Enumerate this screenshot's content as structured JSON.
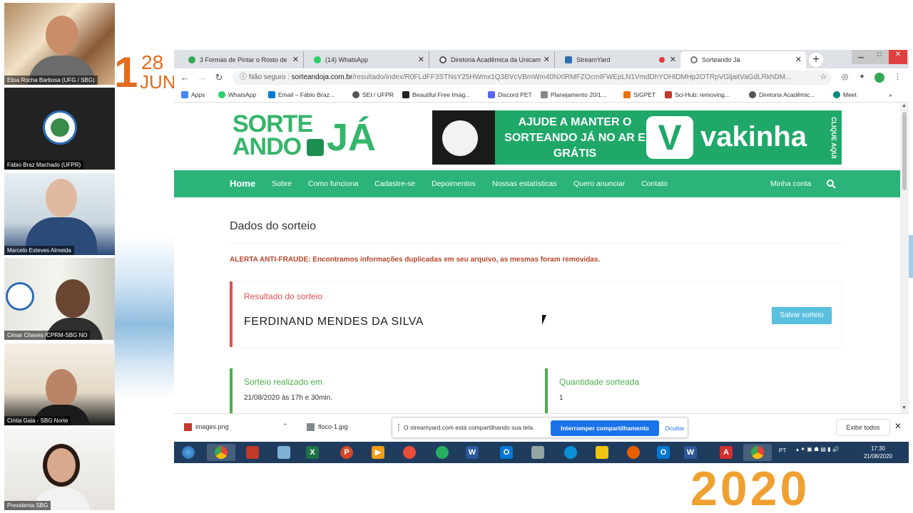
{
  "event": {
    "date_first_digit": "1",
    "date_day": "28",
    "date_month": "JUN",
    "year": "2020"
  },
  "participants": [
    {
      "name": "Elisa Rocha Barbosa (UFG / SBG)"
    },
    {
      "name": "Fábio Braz Machado (UFPR)"
    },
    {
      "name": "Marcelo Esteves Almeida"
    },
    {
      "name": "César Chaves /CPRM-SBG NO"
    },
    {
      "name": "Cintia Gaia - SBG Norte"
    },
    {
      "name": "Presidenta SBG"
    }
  ],
  "browser": {
    "tabs": [
      {
        "label": "3 Formas de Pintar o Rosto de",
        "icon_color": "#34a853"
      },
      {
        "label": "(14) WhatsApp",
        "icon_color": "#25d366"
      },
      {
        "label": "Diretoria Acadêmica da Unicam",
        "icon_color": "#555555"
      },
      {
        "label": "StreamYard",
        "icon_color": "#2f6fb0"
      },
      {
        "label": "Sorteando Já",
        "icon_color": "#777777"
      }
    ],
    "address": {
      "security_label": "Não seguro",
      "domain": "sorteandoja.com.br",
      "path": "/resultado/index/R0FLdFF3STNsY25HWmx1Q3BVcVBmWm40NXlRMFZOcmtFWEpLN1VmdDhYOHlDMHp2OTRpVGljaitVaGdLRkhDM..."
    },
    "bookmarks": [
      {
        "label": "Apps",
        "color": "#4285f4"
      },
      {
        "label": "WhatsApp",
        "color": "#25d366"
      },
      {
        "label": "Email – Fábio Braz...",
        "color": "#0078d4"
      },
      {
        "label": "SEI / UFPR",
        "color": "#555555"
      },
      {
        "label": "Beautiful Free Imag...",
        "color": "#222222"
      },
      {
        "label": "Discord PET",
        "color": "#5865f2"
      },
      {
        "label": "Planejamento 20/1...",
        "color": "#888888"
      },
      {
        "label": "SIGPET",
        "color": "#e8710a"
      },
      {
        "label": "Sci-Hub: removing...",
        "color": "#c0392b"
      },
      {
        "label": "Diretoria Acadêmic...",
        "color": "#555555"
      },
      {
        "label": "Meet",
        "color": "#00897b"
      }
    ]
  },
  "site": {
    "logo": {
      "line1": "SORTE",
      "line2": "ANDO",
      "line3": "JÁ"
    },
    "banner": {
      "message": "AJUDE A MANTER O SORTEANDO JÁ NO AR E GRÁTIS",
      "brand": "vakinha",
      "cta": "CLIQUE AQUI"
    },
    "nav": {
      "items": [
        "Home",
        "Sobre",
        "Como funciona",
        "Cadastre-se",
        "Depoimentos",
        "Nossas estatísticas",
        "Quero anunciar",
        "Contato"
      ],
      "account": "Minha conta"
    },
    "page_title": "Dados do sorteio",
    "alert": "ALERTA ANTI-FRAUDE: Encontramos informações duplicadas em seu arquivo, as mesmas foram removidas.",
    "result": {
      "label": "Resultado do sorteio",
      "winner": "FERDINAND MENDES DA SILVA",
      "save_button": "Salvar sorteio"
    },
    "info": [
      {
        "label": "Sorteio realizado em",
        "value": "21/08/2020 às 17h e 30min."
      },
      {
        "label": "Quantidade sorteada",
        "value": "1"
      }
    ]
  },
  "downloads": {
    "items": [
      "images.png",
      "floco-1.jpg"
    ],
    "share_message": "O streamyard.com está compartilhando sua tela.",
    "stop_button": "Interromper compartilhamento",
    "hide_button": "Ocultar",
    "show_all": "Exibir todos"
  },
  "taskbar": {
    "language": "PT",
    "time": "17:30",
    "date": "21/08/2020"
  },
  "colors": {
    "brand_green": "#2bb37a",
    "alert_red": "#b5452b",
    "result_red": "#d9534f",
    "info_green": "#4cae4c",
    "save_blue": "#5bc0de",
    "chrome_blue": "#1a73e8"
  }
}
